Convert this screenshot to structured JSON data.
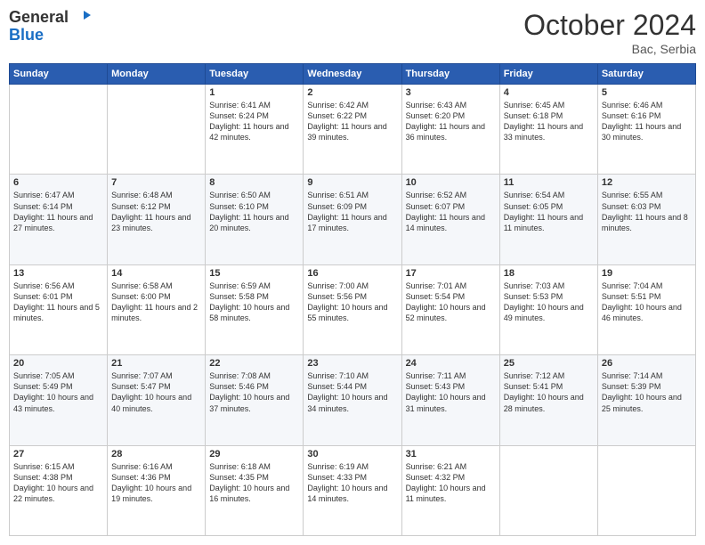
{
  "header": {
    "logo_line1": "General",
    "logo_line2": "Blue",
    "month": "October 2024",
    "location": "Bac, Serbia"
  },
  "days_of_week": [
    "Sunday",
    "Monday",
    "Tuesday",
    "Wednesday",
    "Thursday",
    "Friday",
    "Saturday"
  ],
  "weeks": [
    [
      {
        "day": "",
        "sunrise": "",
        "sunset": "",
        "daylight": ""
      },
      {
        "day": "",
        "sunrise": "",
        "sunset": "",
        "daylight": ""
      },
      {
        "day": "1",
        "sunrise": "Sunrise: 6:41 AM",
        "sunset": "Sunset: 6:24 PM",
        "daylight": "Daylight: 11 hours and 42 minutes."
      },
      {
        "day": "2",
        "sunrise": "Sunrise: 6:42 AM",
        "sunset": "Sunset: 6:22 PM",
        "daylight": "Daylight: 11 hours and 39 minutes."
      },
      {
        "day": "3",
        "sunrise": "Sunrise: 6:43 AM",
        "sunset": "Sunset: 6:20 PM",
        "daylight": "Daylight: 11 hours and 36 minutes."
      },
      {
        "day": "4",
        "sunrise": "Sunrise: 6:45 AM",
        "sunset": "Sunset: 6:18 PM",
        "daylight": "Daylight: 11 hours and 33 minutes."
      },
      {
        "day": "5",
        "sunrise": "Sunrise: 6:46 AM",
        "sunset": "Sunset: 6:16 PM",
        "daylight": "Daylight: 11 hours and 30 minutes."
      }
    ],
    [
      {
        "day": "6",
        "sunrise": "Sunrise: 6:47 AM",
        "sunset": "Sunset: 6:14 PM",
        "daylight": "Daylight: 11 hours and 27 minutes."
      },
      {
        "day": "7",
        "sunrise": "Sunrise: 6:48 AM",
        "sunset": "Sunset: 6:12 PM",
        "daylight": "Daylight: 11 hours and 23 minutes."
      },
      {
        "day": "8",
        "sunrise": "Sunrise: 6:50 AM",
        "sunset": "Sunset: 6:10 PM",
        "daylight": "Daylight: 11 hours and 20 minutes."
      },
      {
        "day": "9",
        "sunrise": "Sunrise: 6:51 AM",
        "sunset": "Sunset: 6:09 PM",
        "daylight": "Daylight: 11 hours and 17 minutes."
      },
      {
        "day": "10",
        "sunrise": "Sunrise: 6:52 AM",
        "sunset": "Sunset: 6:07 PM",
        "daylight": "Daylight: 11 hours and 14 minutes."
      },
      {
        "day": "11",
        "sunrise": "Sunrise: 6:54 AM",
        "sunset": "Sunset: 6:05 PM",
        "daylight": "Daylight: 11 hours and 11 minutes."
      },
      {
        "day": "12",
        "sunrise": "Sunrise: 6:55 AM",
        "sunset": "Sunset: 6:03 PM",
        "daylight": "Daylight: 11 hours and 8 minutes."
      }
    ],
    [
      {
        "day": "13",
        "sunrise": "Sunrise: 6:56 AM",
        "sunset": "Sunset: 6:01 PM",
        "daylight": "Daylight: 11 hours and 5 minutes."
      },
      {
        "day": "14",
        "sunrise": "Sunrise: 6:58 AM",
        "sunset": "Sunset: 6:00 PM",
        "daylight": "Daylight: 11 hours and 2 minutes."
      },
      {
        "day": "15",
        "sunrise": "Sunrise: 6:59 AM",
        "sunset": "Sunset: 5:58 PM",
        "daylight": "Daylight: 10 hours and 58 minutes."
      },
      {
        "day": "16",
        "sunrise": "Sunrise: 7:00 AM",
        "sunset": "Sunset: 5:56 PM",
        "daylight": "Daylight: 10 hours and 55 minutes."
      },
      {
        "day": "17",
        "sunrise": "Sunrise: 7:01 AM",
        "sunset": "Sunset: 5:54 PM",
        "daylight": "Daylight: 10 hours and 52 minutes."
      },
      {
        "day": "18",
        "sunrise": "Sunrise: 7:03 AM",
        "sunset": "Sunset: 5:53 PM",
        "daylight": "Daylight: 10 hours and 49 minutes."
      },
      {
        "day": "19",
        "sunrise": "Sunrise: 7:04 AM",
        "sunset": "Sunset: 5:51 PM",
        "daylight": "Daylight: 10 hours and 46 minutes."
      }
    ],
    [
      {
        "day": "20",
        "sunrise": "Sunrise: 7:05 AM",
        "sunset": "Sunset: 5:49 PM",
        "daylight": "Daylight: 10 hours and 43 minutes."
      },
      {
        "day": "21",
        "sunrise": "Sunrise: 7:07 AM",
        "sunset": "Sunset: 5:47 PM",
        "daylight": "Daylight: 10 hours and 40 minutes."
      },
      {
        "day": "22",
        "sunrise": "Sunrise: 7:08 AM",
        "sunset": "Sunset: 5:46 PM",
        "daylight": "Daylight: 10 hours and 37 minutes."
      },
      {
        "day": "23",
        "sunrise": "Sunrise: 7:10 AM",
        "sunset": "Sunset: 5:44 PM",
        "daylight": "Daylight: 10 hours and 34 minutes."
      },
      {
        "day": "24",
        "sunrise": "Sunrise: 7:11 AM",
        "sunset": "Sunset: 5:43 PM",
        "daylight": "Daylight: 10 hours and 31 minutes."
      },
      {
        "day": "25",
        "sunrise": "Sunrise: 7:12 AM",
        "sunset": "Sunset: 5:41 PM",
        "daylight": "Daylight: 10 hours and 28 minutes."
      },
      {
        "day": "26",
        "sunrise": "Sunrise: 7:14 AM",
        "sunset": "Sunset: 5:39 PM",
        "daylight": "Daylight: 10 hours and 25 minutes."
      }
    ],
    [
      {
        "day": "27",
        "sunrise": "Sunrise: 6:15 AM",
        "sunset": "Sunset: 4:38 PM",
        "daylight": "Daylight: 10 hours and 22 minutes."
      },
      {
        "day": "28",
        "sunrise": "Sunrise: 6:16 AM",
        "sunset": "Sunset: 4:36 PM",
        "daylight": "Daylight: 10 hours and 19 minutes."
      },
      {
        "day": "29",
        "sunrise": "Sunrise: 6:18 AM",
        "sunset": "Sunset: 4:35 PM",
        "daylight": "Daylight: 10 hours and 16 minutes."
      },
      {
        "day": "30",
        "sunrise": "Sunrise: 6:19 AM",
        "sunset": "Sunset: 4:33 PM",
        "daylight": "Daylight: 10 hours and 14 minutes."
      },
      {
        "day": "31",
        "sunrise": "Sunrise: 6:21 AM",
        "sunset": "Sunset: 4:32 PM",
        "daylight": "Daylight: 10 hours and 11 minutes."
      },
      {
        "day": "",
        "sunrise": "",
        "sunset": "",
        "daylight": ""
      },
      {
        "day": "",
        "sunrise": "",
        "sunset": "",
        "daylight": ""
      }
    ]
  ]
}
